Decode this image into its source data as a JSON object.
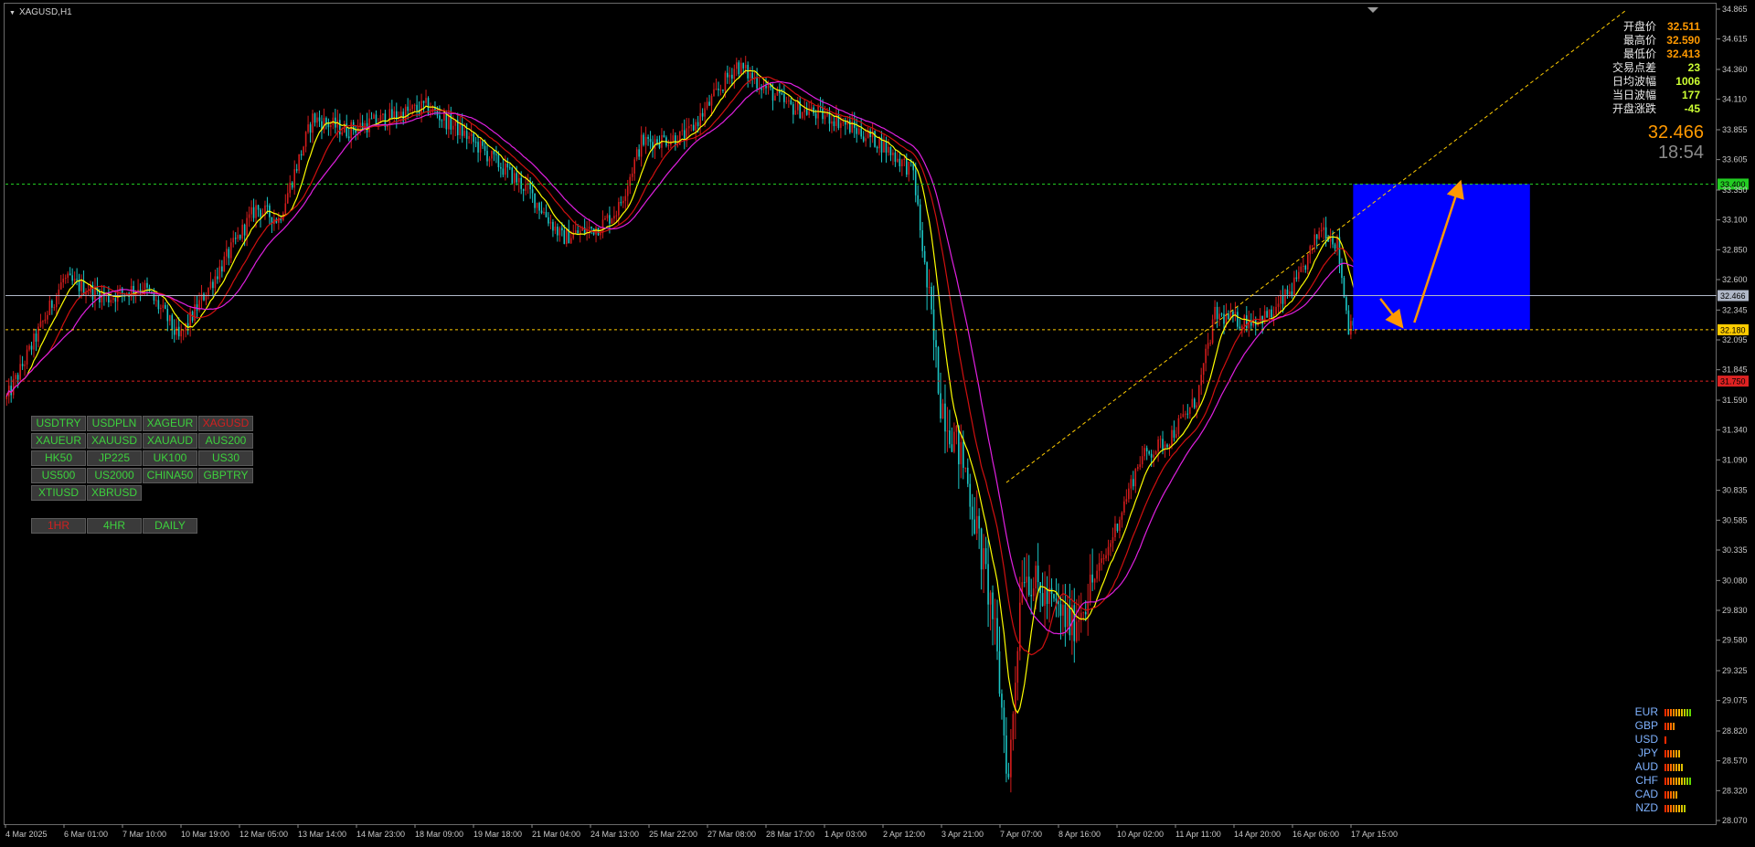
{
  "chart_title": "XAGUSD,H1",
  "info_panel": [
    {
      "label": "开盘价",
      "value": "32.511",
      "color": "#ff9900"
    },
    {
      "label": "最高价",
      "value": "32.590",
      "color": "#ff9900"
    },
    {
      "label": "最低价",
      "value": "32.413",
      "color": "#ff9900"
    },
    {
      "label": "交易点差",
      "value": "23",
      "color": "#ccff33"
    },
    {
      "label": "日均波幅",
      "value": "1006",
      "color": "#ccff33"
    },
    {
      "label": "当日波幅",
      "value": "177",
      "color": "#ccff33"
    },
    {
      "label": "开盘涨跌",
      "value": "-45",
      "color": "#ccff33"
    }
  ],
  "current_price": "32.466",
  "countdown": "18:54",
  "symbol_buttons": [
    "USDTRY",
    "USDPLN",
    "XAGEUR",
    "XAGUSD",
    "XAUEUR",
    "XAUUSD",
    "XAUAUD",
    "AUS200",
    "HK50",
    "JP225",
    "UK100",
    "US30",
    "US500",
    "US2000",
    "CHINA50",
    "GBPTRY",
    "XTIUSD",
    "XBRUSD"
  ],
  "active_symbol": "XAGUSD",
  "timeframe_buttons": [
    "1HR",
    "4HR",
    "DAILY"
  ],
  "active_timeframe": "1HR",
  "currency_strength": [
    {
      "ccy": "EUR",
      "level": 10
    },
    {
      "ccy": "GBP",
      "level": 4
    },
    {
      "ccy": "USD",
      "level": 1
    },
    {
      "ccy": "JPY",
      "level": 6
    },
    {
      "ccy": "AUD",
      "level": 7
    },
    {
      "ccy": "CHF",
      "level": 10
    },
    {
      "ccy": "CAD",
      "level": 5
    },
    {
      "ccy": "NZD",
      "level": 8
    }
  ],
  "chart_data": {
    "type": "candlestick",
    "symbol": "XAGUSD",
    "timeframe": "H1",
    "ylim": [
      28.07,
      34.865
    ],
    "y_ticks": [
      "34.865",
      "34.615",
      "34.360",
      "34.110",
      "33.855",
      "33.605",
      "33.350",
      "33.100",
      "32.850",
      "32.600",
      "32.345",
      "32.095",
      "31.845",
      "31.590",
      "31.340",
      "31.090",
      "30.835",
      "30.585",
      "30.335",
      "30.080",
      "29.830",
      "29.580",
      "29.325",
      "29.075",
      "28.820",
      "28.570",
      "28.320",
      "28.070"
    ],
    "x_ticks": [
      "4 Mar 2025",
      "6 Mar 01:00",
      "7 Mar 10:00",
      "10 Mar 19:00",
      "12 Mar 05:00",
      "13 Mar 14:00",
      "14 Mar 23:00",
      "18 Mar 09:00",
      "19 Mar 18:00",
      "21 Mar 04:00",
      "24 Mar 13:00",
      "25 Mar 22:00",
      "27 Mar 08:00",
      "28 Mar 17:00",
      "1 Apr 03:00",
      "2 Apr 12:00",
      "3 Apr 21:00",
      "7 Apr 07:00",
      "8 Apr 16:00",
      "10 Apr 02:00",
      "11 Apr 11:00",
      "14 Apr 20:00",
      "16 Apr 06:00",
      "17 Apr 15:00"
    ],
    "price_path": [
      [
        0,
        31.6
      ],
      [
        25,
        32.6
      ],
      [
        45,
        32.45
      ],
      [
        60,
        32.55
      ],
      [
        70,
        32.3
      ],
      [
        76,
        32.1
      ],
      [
        88,
        32.5
      ],
      [
        110,
        33.2
      ],
      [
        120,
        33.1
      ],
      [
        135,
        33.95
      ],
      [
        150,
        33.85
      ],
      [
        185,
        34.05
      ],
      [
        200,
        33.85
      ],
      [
        230,
        33.35
      ],
      [
        245,
        32.95
      ],
      [
        262,
        33.05
      ],
      [
        270,
        33.2
      ],
      [
        280,
        33.75
      ],
      [
        300,
        33.8
      ],
      [
        322,
        34.4
      ],
      [
        335,
        34.2
      ],
      [
        345,
        34.05
      ],
      [
        365,
        33.95
      ],
      [
        385,
        33.75
      ],
      [
        400,
        33.5
      ],
      [
        412,
        31.6
      ],
      [
        423,
        31.0
      ],
      [
        435,
        29.8
      ],
      [
        442,
        28.4
      ],
      [
        448,
        30.2
      ],
      [
        455,
        30.0
      ],
      [
        470,
        29.7
      ],
      [
        485,
        30.3
      ],
      [
        500,
        31.1
      ],
      [
        512,
        31.25
      ],
      [
        525,
        31.6
      ],
      [
        533,
        32.3
      ],
      [
        545,
        32.25
      ],
      [
        558,
        32.3
      ],
      [
        570,
        32.6
      ],
      [
        580,
        33.05
      ],
      [
        587,
        32.9
      ],
      [
        592,
        32.2
      ],
      [
        598,
        32.45
      ],
      [
        604,
        32.47
      ]
    ],
    "candle_count": 605,
    "moving_averages": [
      {
        "color": "#ffff00",
        "period": 10
      },
      {
        "color": "#d01010",
        "period": 20
      },
      {
        "color": "#e020e0",
        "period": 30
      }
    ],
    "horizontal_levels": [
      {
        "price": 33.4,
        "label": "33.400",
        "color": "#22cc22",
        "style": "dashed"
      },
      {
        "price": 32.466,
        "label": "32.466",
        "color": "#b0b8c8",
        "style": "solid"
      },
      {
        "price": 32.18,
        "label": "32.180",
        "color": "#ffcc00",
        "style": "dashed"
      },
      {
        "price": 31.75,
        "label": "31.750",
        "color": "#dd2222",
        "style": "dashed"
      }
    ],
    "zone": {
      "from_bar": 594,
      "to_bar": 672,
      "price_low": 32.18,
      "price_high": 33.4,
      "color": "#0000ff"
    },
    "trendline": {
      "from_bar": 441,
      "from_price": 30.9,
      "to_bar": 714,
      "to_price": 34.85,
      "color": "#ffcc00"
    },
    "arrows": [
      {
        "from_bar": 606,
        "from_price": 32.44,
        "to_bar": 615,
        "to_price": 32.22,
        "color": "#ff9900"
      },
      {
        "from_bar": 621,
        "from_price": 32.24,
        "to_bar": 641,
        "to_price": 33.4,
        "color": "#ff9900"
      }
    ],
    "grid": false
  }
}
